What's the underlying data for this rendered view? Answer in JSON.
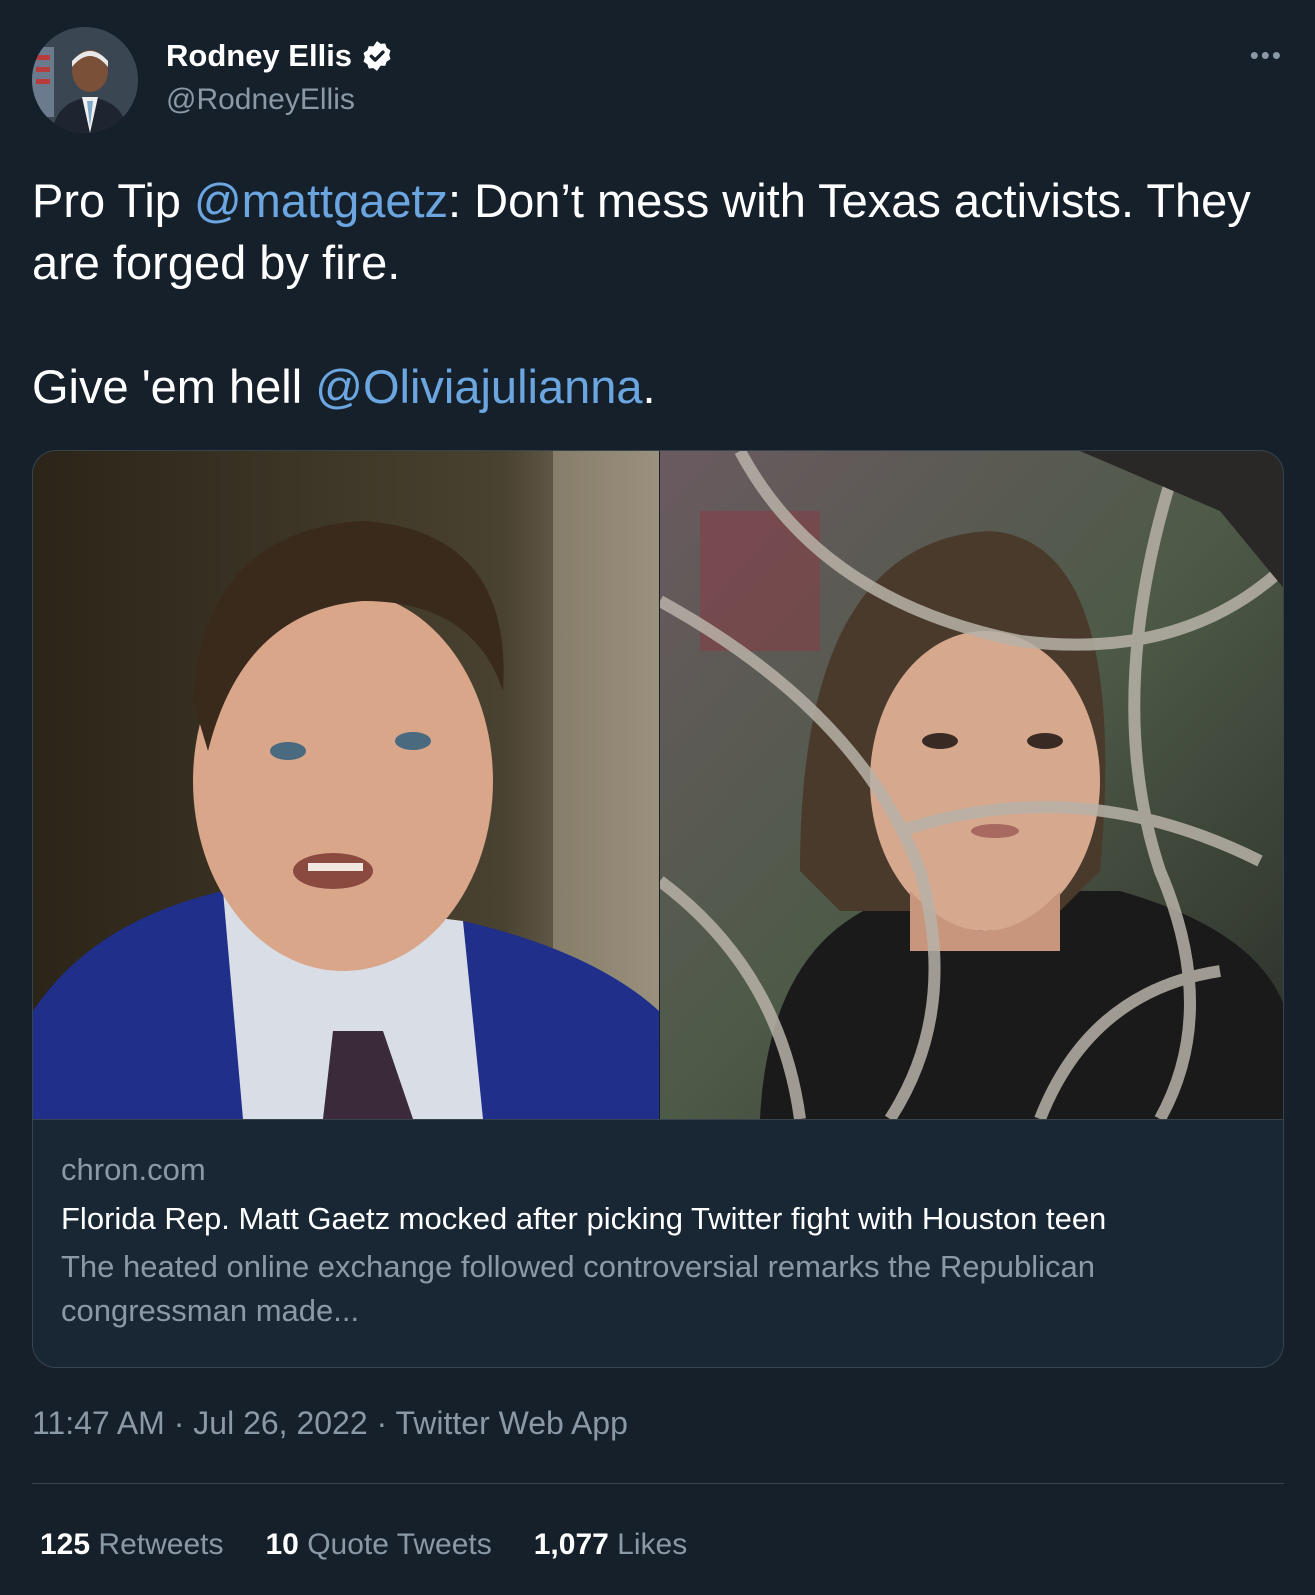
{
  "author": {
    "name": "Rodney Ellis",
    "handle": "@RodneyEllis",
    "verified_icon": "verified-badge-icon"
  },
  "more_label": "•••",
  "tweet": {
    "line1_prefix": "Pro Tip ",
    "mention1": "@mattgaetz",
    "line1_suffix": ": Don’t mess with Texas activists. They are forged by fire.",
    "line2_prefix": "Give 'em hell ",
    "mention2": "@Oliviajulianna",
    "line2_suffix": "."
  },
  "card": {
    "domain": "chron.com",
    "title": "Florida Rep. Matt Gaetz mocked after picking Twitter fight with Houston teen",
    "description": "The heated online exchange followed controversial remarks the Republican congressman made..."
  },
  "meta": {
    "time": "11:47 AM",
    "sep1": " · ",
    "date": "Jul 26, 2022",
    "sep2": " · ",
    "source": "Twitter Web App"
  },
  "stats": {
    "retweets_count": "125",
    "retweets_label": "Retweets",
    "quotes_count": "10",
    "quotes_label": "Quote Tweets",
    "likes_count": "1,077",
    "likes_label": "Likes"
  },
  "colors": {
    "background": "#15202b",
    "link": "#6ba6e0",
    "secondary_text": "#8b98a5",
    "border": "#38444d"
  }
}
